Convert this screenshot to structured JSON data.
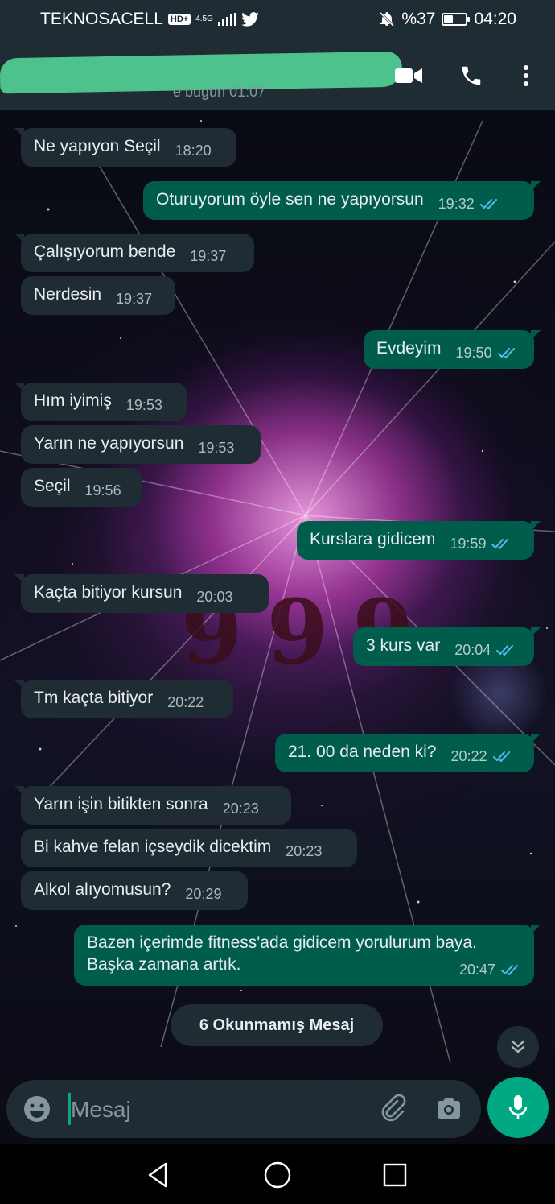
{
  "status_bar": {
    "carrier": "TEKNOSACELL",
    "hd": "HD+",
    "network": "4.5G",
    "battery": "%37",
    "battery_level": 0.37,
    "time": "04:20"
  },
  "header": {
    "subtitle": "e bugün 01:07",
    "icons": [
      "video-call-icon",
      "phone-icon",
      "more-options-icon"
    ]
  },
  "wallpaper_text": "999",
  "messages": [
    {
      "dir": "in",
      "text": "Ne yapıyon Seçil",
      "time": "18:20"
    },
    {
      "dir": "out",
      "text": "Oturuyorum öyle sen ne yapıyorsun",
      "time": "19:32"
    },
    {
      "dir": "in",
      "text": "Çalışıyorum bende",
      "time": "19:37"
    },
    {
      "dir": "in",
      "text": "Nerdesin",
      "time": "19:37"
    },
    {
      "dir": "out",
      "text": "Evdeyim",
      "time": "19:50"
    },
    {
      "dir": "in",
      "text": "Hım iyimiş",
      "time": "19:53"
    },
    {
      "dir": "in",
      "text": "Yarın ne yapıyorsun",
      "time": "19:53"
    },
    {
      "dir": "in",
      "text": "Seçil",
      "time": "19:56"
    },
    {
      "dir": "out",
      "text": "Kurslara gidicem",
      "time": "19:59"
    },
    {
      "dir": "in",
      "text": "Kaçta bitiyor kursun",
      "time": "20:03"
    },
    {
      "dir": "out",
      "text": "3 kurs var",
      "time": "20:04"
    },
    {
      "dir": "in",
      "text": "Tm kaçta bitiyor",
      "time": "20:22"
    },
    {
      "dir": "out",
      "text": "21. 00 da neden ki?",
      "time": "20:22"
    },
    {
      "dir": "in",
      "text": "Yarın işin bitikten sonra",
      "time": "20:23"
    },
    {
      "dir": "in",
      "text": "Bi kahve felan içseydik dicektim",
      "time": "20:23"
    },
    {
      "dir": "in",
      "text": "Alkol alıyomusun?",
      "time": "20:29"
    },
    {
      "dir": "out",
      "text": "Bazen içerimde fitness'ada gidicem yorulurum baya. Başka zamana artık.",
      "time": "20:47"
    }
  ],
  "unread_banner": "6 Okunmamış Mesaj",
  "input": {
    "placeholder": "Mesaj",
    "icons": [
      "emoji-icon",
      "attach-icon",
      "camera-icon",
      "mic-icon"
    ]
  },
  "nav_bar": [
    "back-icon",
    "home-icon",
    "recents-icon"
  ],
  "colors": {
    "header_bg": "#1f2c34",
    "incoming_bubble": "#1f2c34",
    "outgoing_bubble": "#005c4b",
    "accent": "#00a884",
    "read_ticks": "#53bdeb",
    "title_redaction": "#4ec28c"
  }
}
